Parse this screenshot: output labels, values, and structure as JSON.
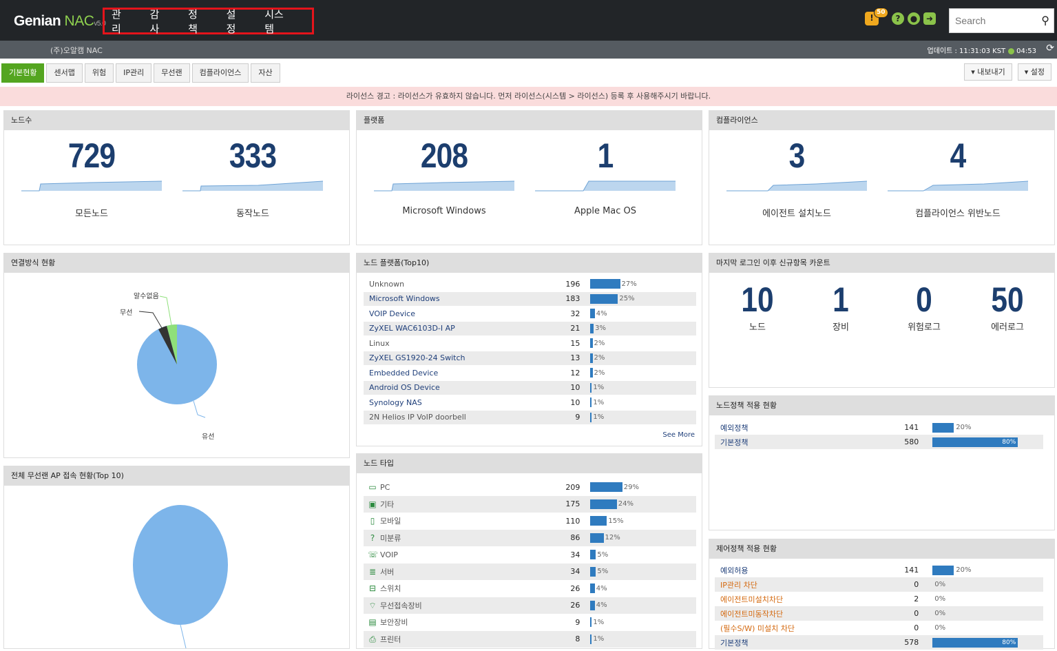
{
  "header": {
    "logo_brand": "Genian",
    "logo_product": "NAC",
    "logo_version": "v5.0",
    "nav": [
      "관리",
      "감사",
      "정책",
      "설정",
      "시스템"
    ],
    "alert_count": "50",
    "search_placeholder": "Search"
  },
  "subbar": {
    "company": "(주)오알캠 NAC",
    "update_label": "업데이트 : 11:31:03 KST",
    "update_elapsed": "04:53"
  },
  "tabs": [
    "기본현황",
    "센서맵",
    "위험",
    "IP관리",
    "무선랜",
    "컴플라이언스",
    "자산"
  ],
  "right_buttons": [
    "▾ 내보내기",
    "▾ 설정"
  ],
  "alert": "라이선스 경고 : 라이선스가 유효하지 않습니다. 먼저 라이선스(시스템 > 라이선스) 등록 후 사용해주시기 바랍니다.",
  "panels": {
    "nodes": {
      "title": "노드수",
      "kpis": [
        {
          "value": "729",
          "label": "모든노드"
        },
        {
          "value": "333",
          "label": "동작노드"
        }
      ]
    },
    "platform": {
      "title": "플랫폼",
      "kpis": [
        {
          "value": "208",
          "label": "Microsoft Windows"
        },
        {
          "value": "1",
          "label": "Apple Mac OS"
        }
      ]
    },
    "compliance": {
      "title": "컴플라이언스",
      "kpis": [
        {
          "value": "3",
          "label": "에이전트 설치노드"
        },
        {
          "value": "4",
          "label": "컴플라이언스 위반노드"
        }
      ]
    },
    "connection": {
      "title": "연결방식 현황",
      "labels": [
        "알수없음",
        "무선",
        "유선"
      ]
    },
    "wireless": {
      "title": "전체 무선랜 AP 접속 현황(Top 10)"
    },
    "node_platform": {
      "title": "노드 플랫폼(Top10)",
      "see_more": "See More",
      "rows": [
        {
          "name": "Unknown",
          "count": "196",
          "pct": 27,
          "pct_text": "27%",
          "link": false
        },
        {
          "name": "Microsoft Windows",
          "count": "183",
          "pct": 25,
          "pct_text": "25%",
          "link": true
        },
        {
          "name": "VOIP Device",
          "count": "32",
          "pct": 4,
          "pct_text": "4%",
          "link": true
        },
        {
          "name": "ZyXEL WAC6103D-I AP",
          "count": "21",
          "pct": 3,
          "pct_text": "3%",
          "link": true
        },
        {
          "name": "Linux",
          "count": "15",
          "pct": 2,
          "pct_text": "2%",
          "link": false
        },
        {
          "name": "ZyXEL GS1920-24 Switch",
          "count": "13",
          "pct": 2,
          "pct_text": "2%",
          "link": true
        },
        {
          "name": "Embedded Device",
          "count": "12",
          "pct": 2,
          "pct_text": "2%",
          "link": true
        },
        {
          "name": "Android OS Device",
          "count": "10",
          "pct": 1,
          "pct_text": "1%",
          "link": true
        },
        {
          "name": "Synology NAS",
          "count": "10",
          "pct": 1,
          "pct_text": "1%",
          "link": true
        },
        {
          "name": "2N Helios IP VoIP doorbell",
          "count": "9",
          "pct": 1,
          "pct_text": "1%",
          "link": false
        }
      ]
    },
    "node_type": {
      "title": "노드 타입",
      "rows": [
        {
          "name": "PC",
          "icon": "pc-icon",
          "glyph": "▭",
          "count": "209",
          "pct": 29,
          "pct_text": "29%"
        },
        {
          "name": "기타",
          "icon": "other-icon",
          "glyph": "▣",
          "count": "175",
          "pct": 24,
          "pct_text": "24%"
        },
        {
          "name": "모바일",
          "icon": "mobile-icon",
          "glyph": "▯",
          "count": "110",
          "pct": 15,
          "pct_text": "15%"
        },
        {
          "name": "미분류",
          "icon": "unknown-icon",
          "glyph": "?",
          "count": "86",
          "pct": 12,
          "pct_text": "12%"
        },
        {
          "name": "VOIP",
          "icon": "phone-icon",
          "glyph": "☏",
          "count": "34",
          "pct": 5,
          "pct_text": "5%"
        },
        {
          "name": "서버",
          "icon": "server-icon",
          "glyph": "≣",
          "count": "34",
          "pct": 5,
          "pct_text": "5%"
        },
        {
          "name": "스위치",
          "icon": "switch-icon",
          "glyph": "⊟",
          "count": "26",
          "pct": 4,
          "pct_text": "4%"
        },
        {
          "name": "무선접속장비",
          "icon": "wifi-icon",
          "glyph": "⌔",
          "count": "26",
          "pct": 4,
          "pct_text": "4%"
        },
        {
          "name": "보안장비",
          "icon": "firewall-icon",
          "glyph": "▤",
          "count": "9",
          "pct": 1,
          "pct_text": "1%"
        },
        {
          "name": "프린터",
          "icon": "printer-icon",
          "glyph": "⎙",
          "count": "8",
          "pct": 1,
          "pct_text": "1%"
        }
      ]
    },
    "since_login": {
      "title": "마지막 로그인 이후 신규항목 카운트",
      "items": [
        {
          "value": "10",
          "label": "노드"
        },
        {
          "value": "1",
          "label": "장비"
        },
        {
          "value": "0",
          "label": "위험로그"
        },
        {
          "value": "50",
          "label": "에러로그"
        }
      ]
    },
    "node_policy": {
      "title": "노드정책 적용 현황",
      "rows": [
        {
          "name": "예외정책",
          "count": "141",
          "pct": 20,
          "pct_text": "20%",
          "orange": false
        },
        {
          "name": "기본정책",
          "count": "580",
          "pct": 80,
          "pct_text": "80%",
          "orange": false
        }
      ]
    },
    "control_policy": {
      "title": "제어정책 적용 현황",
      "rows": [
        {
          "name": "예외허용",
          "count": "141",
          "pct": 20,
          "pct_text": "20%",
          "orange": false
        },
        {
          "name": "IP관리 차단",
          "count": "0",
          "pct": 0,
          "pct_text": "0%",
          "orange": true
        },
        {
          "name": "에이전트미설치차단",
          "count": "2",
          "pct": 0,
          "pct_text": "0%",
          "orange": true
        },
        {
          "name": "에이전트미동작차단",
          "count": "0",
          "pct": 0,
          "pct_text": "0%",
          "orange": true
        },
        {
          "name": "(필수S/W) 미설치 차단",
          "count": "0",
          "pct": 0,
          "pct_text": "0%",
          "orange": true
        },
        {
          "name": "기본정책",
          "count": "578",
          "pct": 80,
          "pct_text": "80%",
          "orange": false
        }
      ]
    }
  },
  "colors": {
    "accent_green": "#54a520",
    "bar_blue": "#2f7bbf",
    "pie_wired": "#7db5ea",
    "pie_wireless": "#333333",
    "pie_unknown": "#8fe07a",
    "header_bg": "#222528",
    "nav_highlight": "#e4141b"
  }
}
